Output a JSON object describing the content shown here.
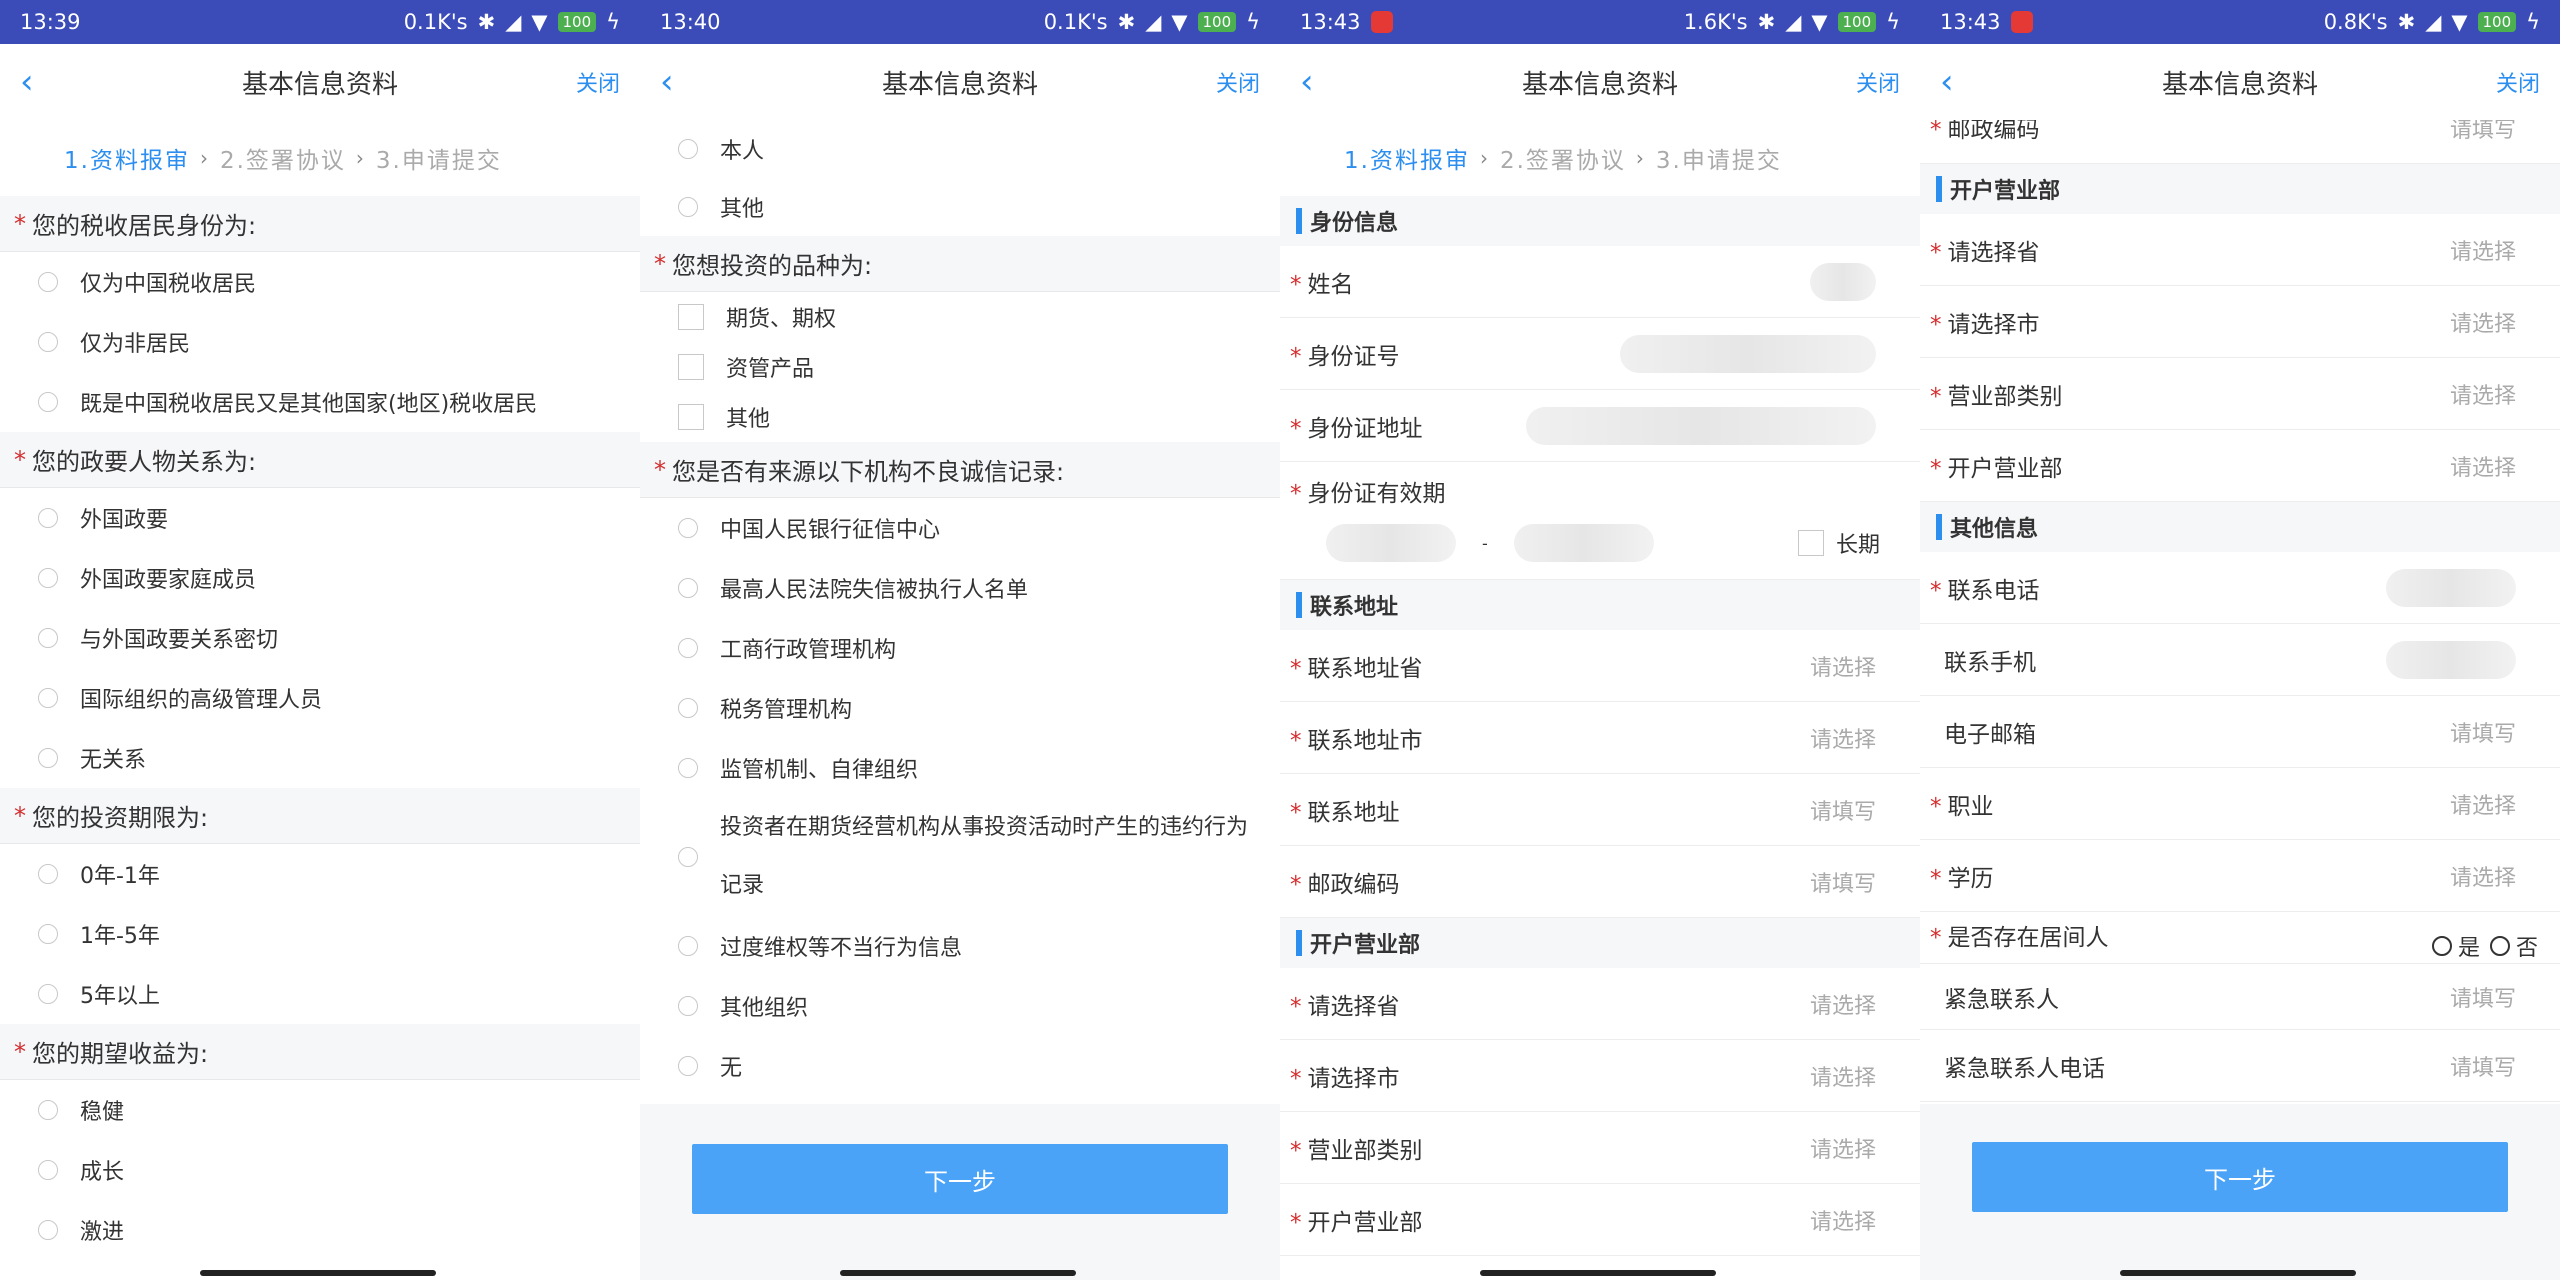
{
  "screen1": {
    "status": {
      "time": "13:39",
      "speed": "0.1K's",
      "battery": "100"
    },
    "nav": {
      "back": "‹",
      "title": "基本信息资料",
      "close": "关闭"
    },
    "steps": [
      "1.资料报审",
      "2.签署协议",
      "3.申请提交"
    ],
    "q1": {
      "title": "您的税收居民身份为:",
      "options": [
        "仅为中国税收居民",
        "仅为非居民",
        "既是中国税收居民又是其他国家(地区)税收居民"
      ]
    },
    "q2": {
      "title": "您的政要人物关系为:",
      "options": [
        "外国政要",
        "外国政要家庭成员",
        "与外国政要关系密切",
        "国际组织的高级管理人员",
        "无关系"
      ]
    },
    "q3": {
      "title": "您的投资期限为:",
      "options": [
        "0年-1年",
        "1年-5年",
        "5年以上"
      ]
    },
    "q4": {
      "title": "您的期望收益为:",
      "options": [
        "稳健",
        "成长",
        "激进"
      ]
    }
  },
  "screen2": {
    "status": {
      "time": "13:40",
      "speed": "0.1K's",
      "battery": "100"
    },
    "nav": {
      "back": "‹",
      "title": "基本信息资料",
      "close": "关闭"
    },
    "top_options": [
      "本人",
      "其他"
    ],
    "q1": {
      "title": "您想投资的品种为:",
      "options": [
        "期货、期权",
        "资管产品",
        "其他"
      ]
    },
    "q2": {
      "title": "您是否有来源以下机构不良诚信记录:",
      "options": [
        "中国人民银行征信中心",
        "最高人民法院失信被执行人名单",
        "工商行政管理机构",
        "税务管理机构",
        "监管机制、自律组织",
        "投资者在期货经营机构从事投资活动时产生的违约行为记录",
        "过度维权等不当行为信息",
        "其他组织",
        "无"
      ]
    },
    "next_label": "下一步"
  },
  "screen3": {
    "status": {
      "time": "13:43",
      "speed": "1.6K's",
      "battery": "100"
    },
    "nav": {
      "back": "‹",
      "title": "基本信息资料",
      "close": "关闭"
    },
    "steps": [
      "1.资料报审",
      "2.签署协议",
      "3.申请提交"
    ],
    "sec_id": "身份信息",
    "name_label": "姓名",
    "id_label": "身份证号",
    "addr_label": "身份证地址",
    "validity_label": "身份证有效期",
    "validity_sep": "-",
    "long_term": "长期",
    "sec_contact": "联系地址",
    "contact_fields": [
      {
        "label": "联系地址省",
        "value": "请选择"
      },
      {
        "label": "联系地址市",
        "value": "请选择"
      },
      {
        "label": "联系地址",
        "value": "请填写"
      },
      {
        "label": "邮政编码",
        "value": "请填写"
      }
    ],
    "sec_branch": "开户营业部",
    "branch_fields": [
      {
        "label": "请选择省",
        "value": "请选择"
      },
      {
        "label": "请选择市",
        "value": "请选择"
      },
      {
        "label": "营业部类别",
        "value": "请选择"
      },
      {
        "label": "开户营业部",
        "value": "请选择"
      }
    ]
  },
  "screen4": {
    "status": {
      "time": "13:43",
      "speed": "0.8K's",
      "battery": "100"
    },
    "nav": {
      "back": "‹",
      "title": "基本信息资料",
      "close": "关闭"
    },
    "top_field": {
      "label": "邮政编码",
      "value": "请填写"
    },
    "sec_branch": "开户营业部",
    "branch_fields": [
      {
        "label": "请选择省",
        "value": "请选择"
      },
      {
        "label": "请选择市",
        "value": "请选择"
      },
      {
        "label": "营业部类别",
        "value": "请选择"
      },
      {
        "label": "开户营业部",
        "value": "请选择"
      }
    ],
    "sec_other": "其他信息",
    "phone_label": "联系电话",
    "mobile_label": "联系手机",
    "email": {
      "label": "电子邮箱",
      "value": "请填写"
    },
    "job": {
      "label": "职业",
      "value": "请选择"
    },
    "edu": {
      "label": "学历",
      "value": "请选择"
    },
    "resident": {
      "label": "是否存在居间人",
      "yes": "是",
      "no": "否"
    },
    "emergency": {
      "label": "紧急联系人",
      "value": "请填写"
    },
    "emergency_phone": {
      "label": "紧急联系人电话",
      "value": "请填写"
    },
    "next_label": "下一步"
  }
}
